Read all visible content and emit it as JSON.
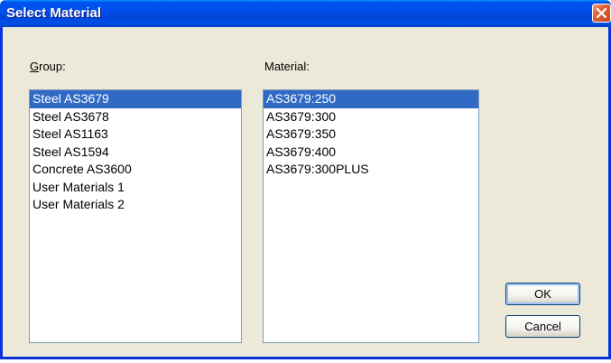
{
  "window": {
    "title": "Select Material"
  },
  "group": {
    "label_mnemonic": "G",
    "label_rest": "roup:",
    "items": [
      {
        "label": "Steel AS3679",
        "selected": true
      },
      {
        "label": "Steel AS3678",
        "selected": false
      },
      {
        "label": "Steel AS1163",
        "selected": false
      },
      {
        "label": "Steel AS1594",
        "selected": false
      },
      {
        "label": "Concrete AS3600",
        "selected": false
      },
      {
        "label": "User Materials 1",
        "selected": false
      },
      {
        "label": "User Materials 2",
        "selected": false
      }
    ]
  },
  "material": {
    "label": "Material:",
    "items": [
      {
        "label": "AS3679:250",
        "selected": true
      },
      {
        "label": "AS3679:300",
        "selected": false
      },
      {
        "label": "AS3679:350",
        "selected": false
      },
      {
        "label": "AS3679:400",
        "selected": false
      },
      {
        "label": "AS3679:300PLUS",
        "selected": false
      }
    ]
  },
  "buttons": {
    "ok_label": "OK",
    "cancel_label": "Cancel"
  },
  "colors": {
    "selection": "#316ac5",
    "titlebar": "#0050ee",
    "dialog_face": "#ece9d8",
    "close_button": "#e0643a"
  }
}
